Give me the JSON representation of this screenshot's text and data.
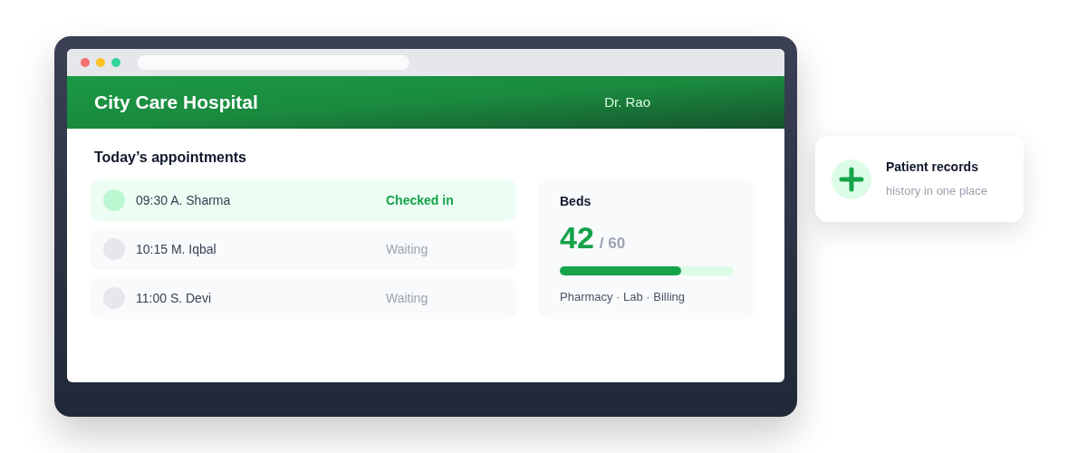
{
  "header": {
    "title": "City Care Hospital",
    "user": "Dr. Rao"
  },
  "appointments": {
    "title": "Today’s appointments",
    "rows": [
      {
        "text": "09:30 A. Sharma",
        "status": "Checked in",
        "checked_in": true
      },
      {
        "text": "10:15 M. Iqbal",
        "status": "Waiting",
        "checked_in": false
      },
      {
        "text": "11:00 S. Devi",
        "status": "Waiting",
        "checked_in": false
      }
    ]
  },
  "beds": {
    "title": "Beds",
    "count": "42",
    "total": "/ 60",
    "level": 0.7,
    "footer": "Pharmacy · Lab · Billing"
  },
  "floating_card": {
    "title": "Patient records",
    "subtitle": "history in one place"
  }
}
